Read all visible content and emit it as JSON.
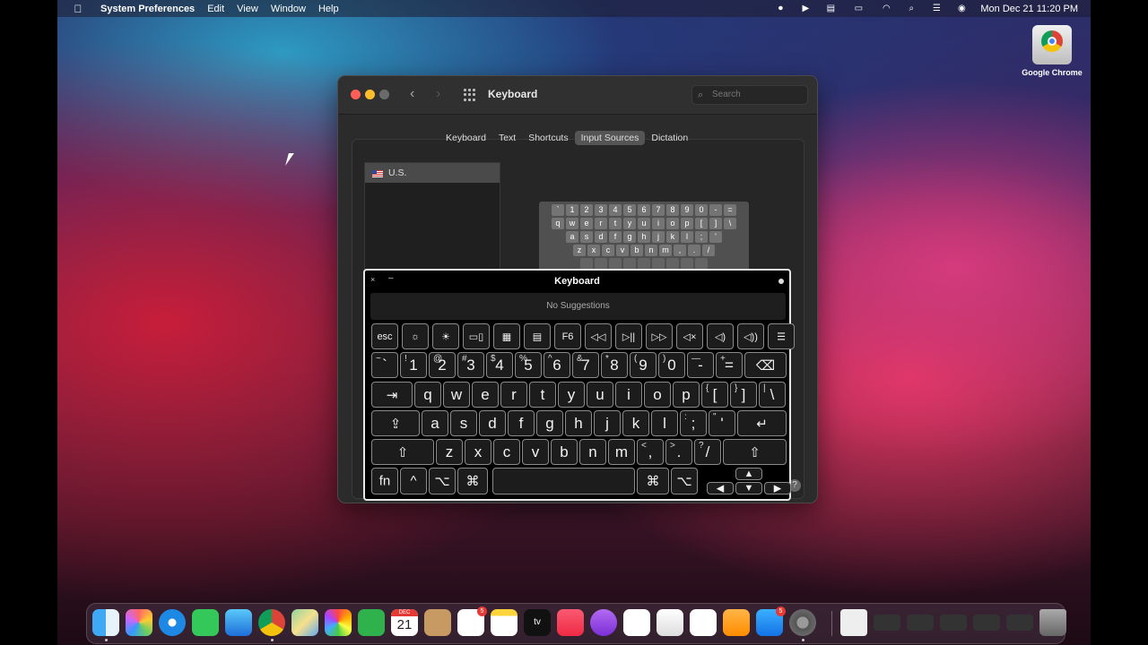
{
  "menubar": {
    "app_name": "System Preferences",
    "menus": [
      "Edit",
      "View",
      "Window",
      "Help"
    ],
    "datetime": "Mon Dec 21  11:20 PM"
  },
  "desktop": {
    "chrome_icon_label": "Google Chrome"
  },
  "prefs_window": {
    "title": "Keyboard",
    "search_placeholder": "Search",
    "tabs": [
      "Keyboard",
      "Text",
      "Shortcuts",
      "Input Sources",
      "Dictation"
    ],
    "selected_tab": "Input Sources",
    "input_sources": [
      "U.S."
    ],
    "preview_rows": [
      [
        "`",
        "1",
        "2",
        "3",
        "4",
        "5",
        "6",
        "7",
        "8",
        "9",
        "0",
        "-",
        "="
      ],
      [
        "q",
        "w",
        "e",
        "r",
        "t",
        "y",
        "u",
        "i",
        "o",
        "p",
        "[",
        "]",
        "\\"
      ],
      [
        "a",
        "s",
        "d",
        "f",
        "g",
        "h",
        "j",
        "k",
        "l",
        ";",
        "'"
      ],
      [
        "z",
        "x",
        "c",
        "v",
        "b",
        "n",
        "m",
        ",",
        ".",
        "/"
      ]
    ]
  },
  "keyboard_viewer": {
    "title": "Keyboard",
    "suggestions": "No Suggestions",
    "close_glyph": "×",
    "minimize_glyph": "–",
    "fn_row": [
      "esc",
      "☼",
      "☀",
      "▭▯",
      "▦",
      "▤",
      "F6",
      "◁◁",
      "▷||",
      "▷▷",
      "◁×",
      "◁)",
      "◁))",
      "☰"
    ],
    "row1": [
      [
        "~",
        "`"
      ],
      [
        "!",
        "1"
      ],
      [
        "@",
        "2"
      ],
      [
        "#",
        "3"
      ],
      [
        "$",
        "4"
      ],
      [
        "%",
        "5"
      ],
      [
        "^",
        "6"
      ],
      [
        "&",
        "7"
      ],
      [
        "*",
        "8"
      ],
      [
        "(",
        "9"
      ],
      [
        ")",
        "0"
      ],
      [
        "—",
        "-"
      ],
      [
        "+",
        "="
      ]
    ],
    "row1_delete": "⌫",
    "row2_tab": "⇥",
    "row2": [
      [
        "",
        "q"
      ],
      [
        "",
        "w"
      ],
      [
        "",
        "e"
      ],
      [
        "",
        "r"
      ],
      [
        "",
        "t"
      ],
      [
        "",
        "y"
      ],
      [
        "",
        "u"
      ],
      [
        "",
        "i"
      ],
      [
        "",
        "o"
      ],
      [
        "",
        "p"
      ],
      [
        "{",
        "["
      ],
      [
        "}",
        "]"
      ],
      [
        "|",
        "\\"
      ]
    ],
    "row3_caps": "⇪",
    "row3": [
      [
        "",
        "a"
      ],
      [
        "",
        "s"
      ],
      [
        "",
        "d"
      ],
      [
        "",
        "f"
      ],
      [
        "",
        "g"
      ],
      [
        "",
        "h"
      ],
      [
        "",
        "j"
      ],
      [
        "",
        "k"
      ],
      [
        "",
        "l"
      ],
      [
        ":",
        ";"
      ],
      [
        "\"",
        "'"
      ]
    ],
    "row3_return": "↵",
    "row4_shift": "⇧",
    "row4": [
      [
        "",
        "z"
      ],
      [
        "",
        "x"
      ],
      [
        "",
        "c"
      ],
      [
        "",
        "v"
      ],
      [
        "",
        "b"
      ],
      [
        "",
        "n"
      ],
      [
        "",
        "m"
      ],
      [
        "<",
        ","
      ],
      [
        ">",
        "."
      ],
      [
        "?",
        "/"
      ]
    ],
    "row5": {
      "fn": "fn",
      "control": "^",
      "option": "⌥",
      "command": "⌘",
      "arrows": [
        "▲",
        "◀",
        "▼",
        "▶"
      ]
    }
  },
  "dock": {
    "calendar_month": "DEC",
    "calendar_day": "21",
    "badges": {
      "reminders": "5",
      "appstore": "5"
    },
    "tv_label": "tv"
  },
  "colors": {
    "accent_close": "#ff5f57",
    "accent_min": "#febc2e",
    "accent_max": "#6b6b6b"
  }
}
